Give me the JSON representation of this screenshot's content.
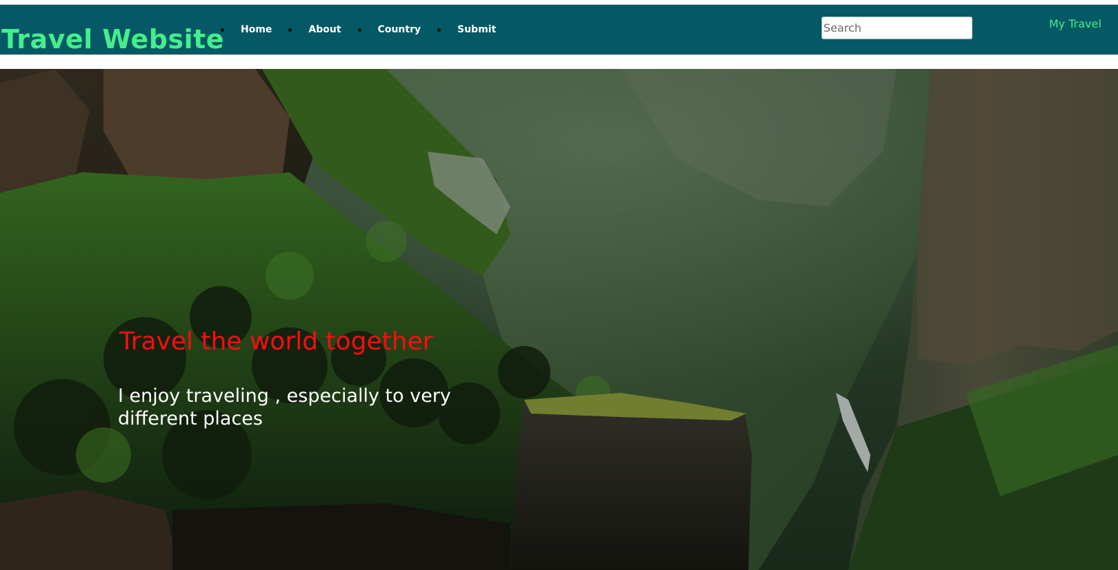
{
  "header": {
    "brand": "Travel Website",
    "nav": [
      {
        "label": "Home"
      },
      {
        "label": "About"
      },
      {
        "label": "Country"
      },
      {
        "label": "Submit"
      }
    ],
    "search": {
      "placeholder": "Search",
      "value": ""
    },
    "right_link": "My Travel",
    "background_color": "#055965",
    "accent_color": "#44ee8c"
  },
  "hero": {
    "title": "Travel the world together",
    "text": "I enjoy traveling , especially to very different places",
    "title_color": "#ff0d0d",
    "text_color": "#ffffff"
  }
}
